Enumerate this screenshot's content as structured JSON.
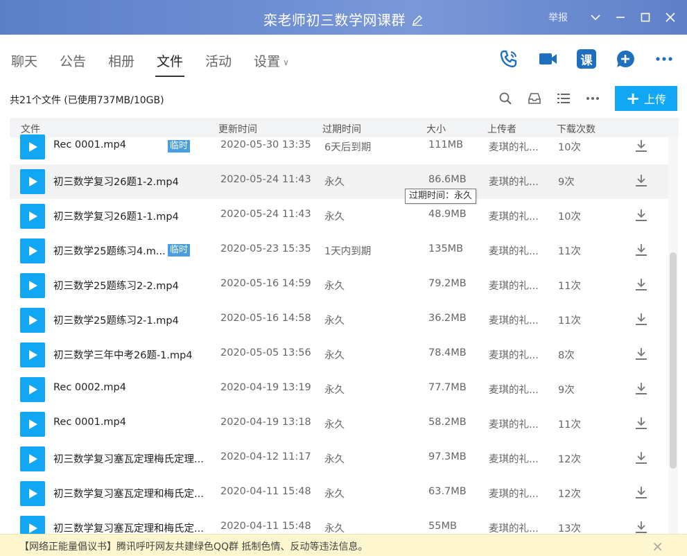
{
  "window": {
    "title": "栾老师初三数学网课群",
    "report_label": "举报"
  },
  "nav": {
    "tabs": [
      {
        "label": "聊天"
      },
      {
        "label": "公告"
      },
      {
        "label": "相册"
      },
      {
        "label": "文件"
      },
      {
        "label": "活动"
      },
      {
        "label": "设置"
      }
    ],
    "active_tab": "文件",
    "course_icon_label": "课"
  },
  "toolbar": {
    "summary": "共21个文件 (已使用737MB/10GB)",
    "upload_label": "上传"
  },
  "table": {
    "headers": [
      "文件",
      "更新时间",
      "过期时间",
      "大小",
      "上传者",
      "下载次数"
    ],
    "rows": [
      {
        "name": "Rec 0001.mp4",
        "tag": "临时",
        "updated": "2020-05-30 13:35",
        "expiry": "6天后到期",
        "size": "111MB",
        "uploader": "麦琪的礼...",
        "downloads": "10次"
      },
      {
        "name": "初三数学复习26题1-2.mp4",
        "tag": "",
        "updated": "2020-05-24 11:43",
        "expiry": "永久",
        "size": "86.6MB",
        "uploader": "麦琪的礼...",
        "downloads": "9次"
      },
      {
        "name": "初三数学复习26题1-1.mp4",
        "tag": "",
        "updated": "2020-05-24 11:43",
        "expiry": "永久",
        "size": "48.9MB",
        "uploader": "麦琪的礼...",
        "downloads": "10次"
      },
      {
        "name": "初三数学25题练习4.m...",
        "tag": "临时",
        "updated": "2020-05-23 15:35",
        "expiry": "1天内到期",
        "size": "135MB",
        "uploader": "麦琪的礼...",
        "downloads": "11次"
      },
      {
        "name": "初三数学25题练习2-2.mp4",
        "tag": "",
        "updated": "2020-05-16 14:59",
        "expiry": "永久",
        "size": "79.2MB",
        "uploader": "麦琪的礼...",
        "downloads": "11次"
      },
      {
        "name": "初三数学25题练习2-1.mp4",
        "tag": "",
        "updated": "2020-05-16 14:58",
        "expiry": "永久",
        "size": "36.2MB",
        "uploader": "麦琪的礼...",
        "downloads": "11次"
      },
      {
        "name": "初三数学三年中考26题-1.mp4",
        "tag": "",
        "updated": "2020-05-05 13:56",
        "expiry": "永久",
        "size": "78.4MB",
        "uploader": "麦琪的礼...",
        "downloads": "8次"
      },
      {
        "name": "Rec 0002.mp4",
        "tag": "",
        "updated": "2020-04-19 13:19",
        "expiry": "永久",
        "size": "77.7MB",
        "uploader": "麦琪的礼...",
        "downloads": "9次"
      },
      {
        "name": "Rec 0001.mp4",
        "tag": "",
        "updated": "2020-04-19 13:18",
        "expiry": "永久",
        "size": "58.2MB",
        "uploader": "麦琪的礼...",
        "downloads": "11次"
      },
      {
        "name": "初三数学复习塞瓦定理梅氏定理...",
        "tag": "",
        "updated": "2020-04-12 11:17",
        "expiry": "永久",
        "size": "97.3MB",
        "uploader": "麦琪的礼...",
        "downloads": "12次"
      },
      {
        "name": "初三数学复习塞瓦定理和梅氏定...",
        "tag": "",
        "updated": "2020-04-11 15:48",
        "expiry": "永久",
        "size": "63.7MB",
        "uploader": "麦琪的礼...",
        "downloads": "12次"
      },
      {
        "name": "初三数学复习塞瓦定理和梅氏定...",
        "tag": "",
        "updated": "2020-04-11 15:48",
        "expiry": "永久",
        "size": "55MB",
        "uploader": "麦琪的礼...",
        "downloads": "13次"
      }
    ]
  },
  "tooltip": {
    "text": "过期时间：永久"
  },
  "banner": {
    "text": "【网络正能量倡议书】腾讯呼吁网友共建绿色QQ群 抵制色情、反动等违法信息。"
  },
  "colors": {
    "accent": "#12a7f4",
    "tag": "#4a9fe3",
    "titlebar": "#6f8fd4",
    "icon_blue": "#1f6fbf"
  }
}
